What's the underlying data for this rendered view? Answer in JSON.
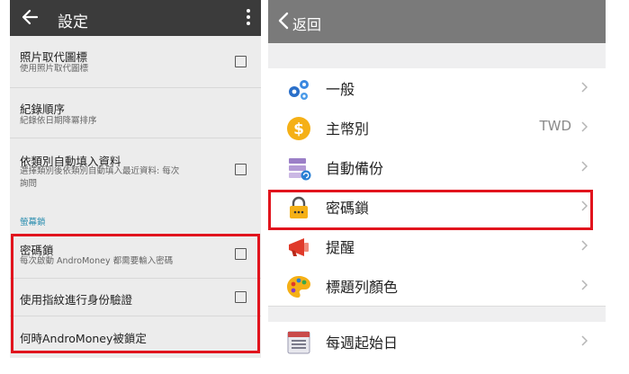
{
  "left": {
    "title": "設定",
    "rows": [
      {
        "title": "照片取代圖標",
        "subtitle": "使用照片取代圖標",
        "checkbox": true
      },
      {
        "title": "紀錄順序",
        "subtitle": "紀錄依日期降冪排序",
        "checkbox": false
      },
      {
        "title": "依類別自動填入資料",
        "subtitle": "選擇類別後依類別自動填入最近資料: 每次詢問",
        "checkbox": true
      }
    ],
    "section_label": "螢幕鎖",
    "lock_rows": [
      {
        "title": "密碼鎖",
        "subtitle": "每次啟動 AndroMoney 都需要輸入密碼",
        "checkbox": true
      },
      {
        "title": "使用指紋進行身份驗證",
        "checkbox": true
      },
      {
        "title": "何時AndroMoney被鎖定",
        "checkbox": false
      }
    ],
    "accent_color": "#2e8fb0"
  },
  "right": {
    "back_label": "返回",
    "items": [
      {
        "icon": "gears-icon",
        "label": "一般",
        "value": ""
      },
      {
        "icon": "dollar-coin-icon",
        "label": "主幣別",
        "value": "TWD"
      },
      {
        "icon": "backup-icon",
        "label": "自動備份",
        "value": ""
      },
      {
        "icon": "padlock-icon",
        "label": "密碼鎖",
        "value": ""
      },
      {
        "icon": "megaphone-icon",
        "label": "提醒",
        "value": ""
      },
      {
        "icon": "palette-icon",
        "label": "標題列顏色",
        "value": ""
      },
      {
        "icon": "calendar-list-icon",
        "label": "每週起始日",
        "value": ""
      }
    ]
  },
  "highlight_color": "#e1141d"
}
